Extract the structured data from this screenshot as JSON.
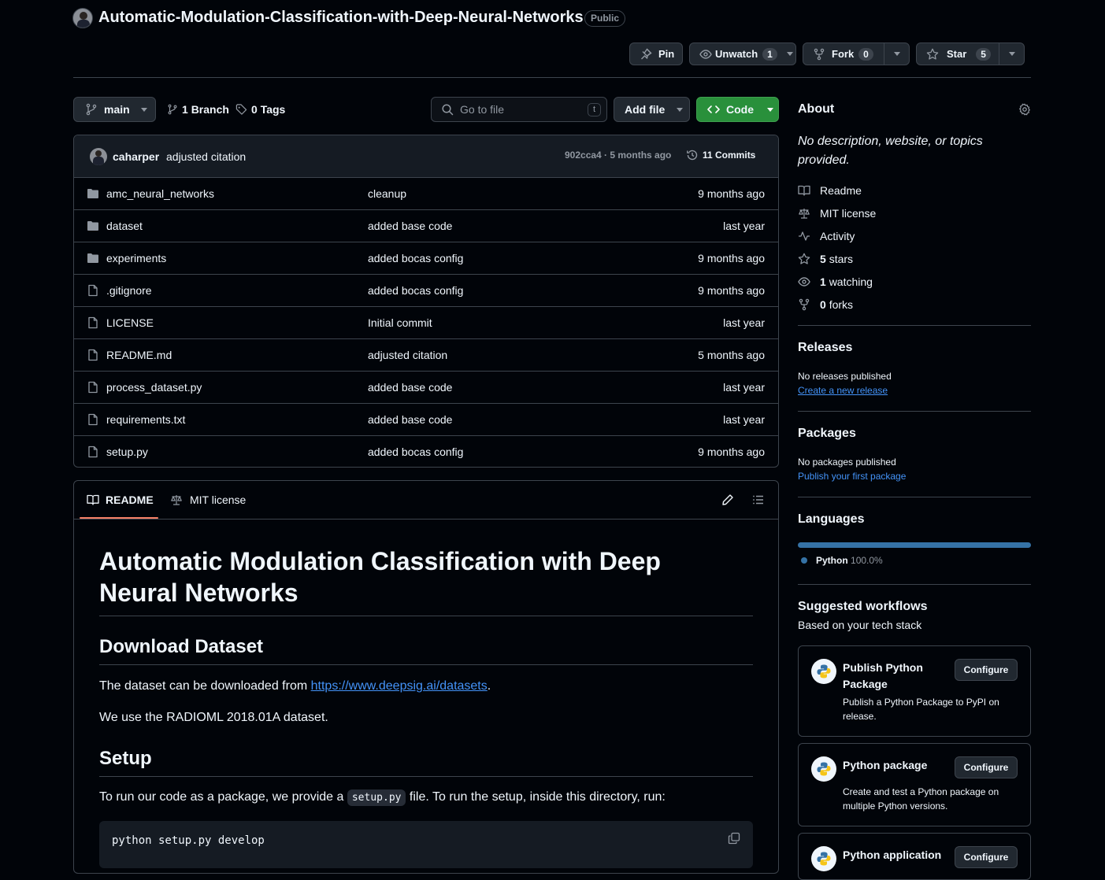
{
  "repo": {
    "title": "Automatic-Modulation-Classification-with-Deep-Neural-Networks",
    "visibility": "Public"
  },
  "actions": {
    "pin": "Pin",
    "unwatch": "Unwatch",
    "watch_count": "1",
    "fork": "Fork",
    "fork_count": "0",
    "star": "Star",
    "star_count": "5"
  },
  "toolbar": {
    "branch": "main",
    "branches_count": "1",
    "branches_label": "Branch",
    "tags_count": "0",
    "tags_label": "Tags",
    "search_placeholder": "Go to file",
    "search_shortcut": "t",
    "add_file": "Add file",
    "code": "Code"
  },
  "commit": {
    "author": "caharper",
    "message": "adjusted citation",
    "hash_time": "902cca4 · 5 months ago",
    "commits": "11 Commits"
  },
  "files": [
    {
      "type": "folder",
      "name": "amc_neural_networks",
      "message": "cleanup",
      "date": "9 months ago"
    },
    {
      "type": "folder",
      "name": "dataset",
      "message": "added base code",
      "date": "last year"
    },
    {
      "type": "folder",
      "name": "experiments",
      "message": "added bocas config",
      "date": "9 months ago"
    },
    {
      "type": "file",
      "name": ".gitignore",
      "message": "added bocas config",
      "date": "9 months ago"
    },
    {
      "type": "file",
      "name": "LICENSE",
      "message": "Initial commit",
      "date": "last year"
    },
    {
      "type": "file",
      "name": "README.md",
      "message": "adjusted citation",
      "date": "5 months ago"
    },
    {
      "type": "file",
      "name": "process_dataset.py",
      "message": "added base code",
      "date": "last year"
    },
    {
      "type": "file",
      "name": "requirements.txt",
      "message": "added base code",
      "date": "last year"
    },
    {
      "type": "file",
      "name": "setup.py",
      "message": "added bocas config",
      "date": "9 months ago"
    }
  ],
  "readme": {
    "tab_readme": "README",
    "tab_license": "MIT license",
    "h1": "Automatic Modulation Classification with Deep Neural Networks",
    "h2_download": "Download Dataset",
    "p_download_prefix": "The dataset can be downloaded from ",
    "p_download_link": "https://www.deepsig.ai/datasets",
    "p_download_suffix": ".",
    "p_dataset": "We use the RADIOML 2018.01A dataset.",
    "h2_setup": "Setup",
    "p_setup_prefix": "To run our code as a package, we provide a ",
    "p_setup_code": "setup.py",
    "p_setup_suffix": " file. To run the setup, inside this directory, run:",
    "code_block": "python setup.py develop"
  },
  "about": {
    "title": "About",
    "description": "No description, website, or topics provided.",
    "readme": "Readme",
    "license": "MIT license",
    "activity": "Activity",
    "stars_count": "5",
    "stars_label": "stars",
    "watching_count": "1",
    "watching_label": "watching",
    "forks_count": "0",
    "forks_label": "forks"
  },
  "releases": {
    "title": "Releases",
    "empty": "No releases published",
    "link": "Create a new release"
  },
  "packages": {
    "title": "Packages",
    "empty": "No packages published",
    "link": "Publish your first package"
  },
  "languages": {
    "title": "Languages",
    "items": [
      {
        "name": "Python",
        "percent": "100.0%",
        "fraction": 1.0,
        "color": "#3572A5"
      }
    ]
  },
  "workflows": {
    "title": "Suggested workflows",
    "subtitle": "Based on your tech stack",
    "configure": "Configure",
    "items": [
      {
        "title": "Publish Python Package",
        "desc": "Publish a Python Package to PyPI on release."
      },
      {
        "title": "Python package",
        "desc": "Create and test a Python package on multiple Python versions."
      },
      {
        "title": "Python application",
        "desc": ""
      }
    ]
  }
}
